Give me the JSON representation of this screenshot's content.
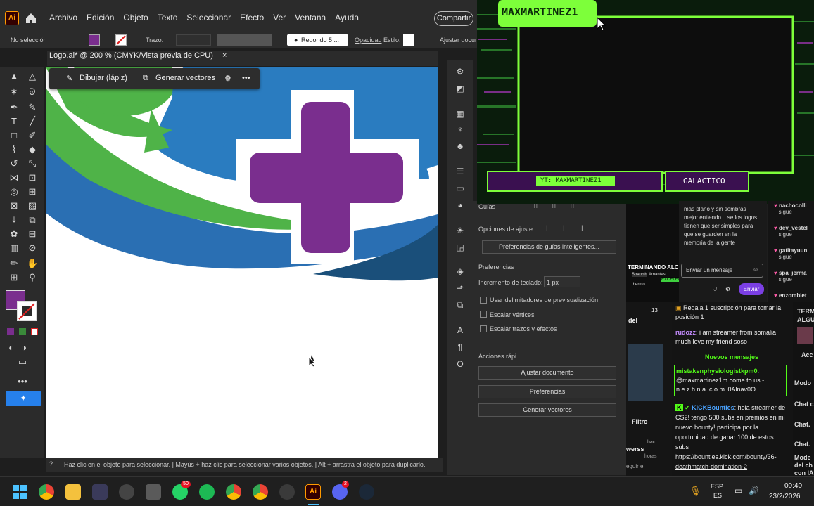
{
  "menu": [
    "Archivo",
    "Edición",
    "Objeto",
    "Texto",
    "Seleccionar",
    "Efecto",
    "Ver",
    "Ventana",
    "Ayuda"
  ],
  "share_label": "Compartir",
  "control_bar": {
    "selection": "No selección",
    "stroke_label": "Trazo:",
    "brush_label": "Redondo 5 ...",
    "opacity_label": "Opacidad",
    "style_label": "Estilo:",
    "adjust_label": "Ajustar docum"
  },
  "document_tab": {
    "title": "Logo.ai* @ 200 % (CMYK/Vista previa de CPU)",
    "close": "×"
  },
  "context_bar": {
    "draw": "Dibujar (lápiz)",
    "vectorize": "Generar vectores"
  },
  "status_text": "Haz clic en el objeto para seleccionar.  |  Mayús + haz clic para seleccionar varios objetos.  |  Alt + arrastra el objeto para duplicarlo.",
  "properties": {
    "guides": "Guías",
    "snap_options": "Opciones de ajuste",
    "smart_guides_btn": "Preferencias de guías inteligentes...",
    "preferences": "Preferencias",
    "keyboard_increment_label": "Incremento de teclado:",
    "keyboard_increment_value": "1 px",
    "check1": "Usar delimitadores de previsualización",
    "check2": "Escalar vértices",
    "check3": "Escalar trazos y efectos",
    "quick_actions": "Acciones rápi...",
    "btn_adjust": "Ajustar documento",
    "btn_prefs": "Preferencias",
    "btn_vectors": "Generar vectores"
  },
  "stream": {
    "name": "MAXMARTINEZ1",
    "yt_label": "YT: MAXMARTINEZ1",
    "galactico": "GALACTICO"
  },
  "mini_chat": {
    "text": "mas plano y sin sombras mejor entiendo... se los logos tienen que ser simples para que se guarden en la memoria de la gente",
    "input_placeholder": "Enviar un mensaje",
    "send": "Enviar"
  },
  "follows": [
    {
      "name": "nachocolli",
      "sub": "sigue"
    },
    {
      "name": "dev_vestel",
      "sub": "sigue"
    },
    {
      "name": "gatitayuun",
      "sub": "sigue"
    },
    {
      "name": "spa_jerma",
      "sub": "sigue"
    },
    {
      "name": "enzombiet",
      "sub": ""
    }
  ],
  "stream_preview": {
    "title": "TERMINANDO ALC",
    "tag1": "Spanish",
    "tag2": "Amantes",
    "tag3": "EXCELEN",
    "tag4": "thermo..."
  },
  "chat": {
    "gift": "Regala 1 suscripción para tomar la posición 1",
    "m1_user": "rudozz",
    "m1_text": ": i am streamer from somalia much love my friend soso",
    "new_messages": "Nuevos mensajes",
    "m2_user": "mistakenphysiologistkpm0",
    "m2_text": ": @maxmartinez1m come to us - n.e.z.h.n.a .c.o.m l0Alnav0O",
    "m3_user": "KICKBounties",
    "m3_text": ": hola streamer de CS2! tengo 500 subs en premios en mi nuevo bounty! participa por la oportunidad de ganar 100 de estos subs",
    "m3_link": "https://bounties.kick.com/bounty/36-deathmatch-domination-2"
  },
  "side_texts": {
    "del": "del",
    "filtro": "Filtro",
    "werss": "werss",
    "seguir": "eguir el",
    "hace": "hac",
    "horas": "horas",
    "num": "13"
  },
  "far_right": [
    "TERM",
    "ALGU",
    "Acc",
    "Modo",
    "Chat c",
    "Chat.",
    "Chat.",
    "Mode",
    "del ch",
    "con IA"
  ],
  "taskbar": {
    "lang1": "ESP",
    "lang2": "ES",
    "time": "00:40",
    "date": "23/2/2026",
    "badge1": "50",
    "badge2": "2"
  },
  "colors": {
    "purple": "#7a2e8e",
    "green": "#4fb348",
    "blue": "#2a7cc0",
    "neon": "#7dff3a"
  }
}
